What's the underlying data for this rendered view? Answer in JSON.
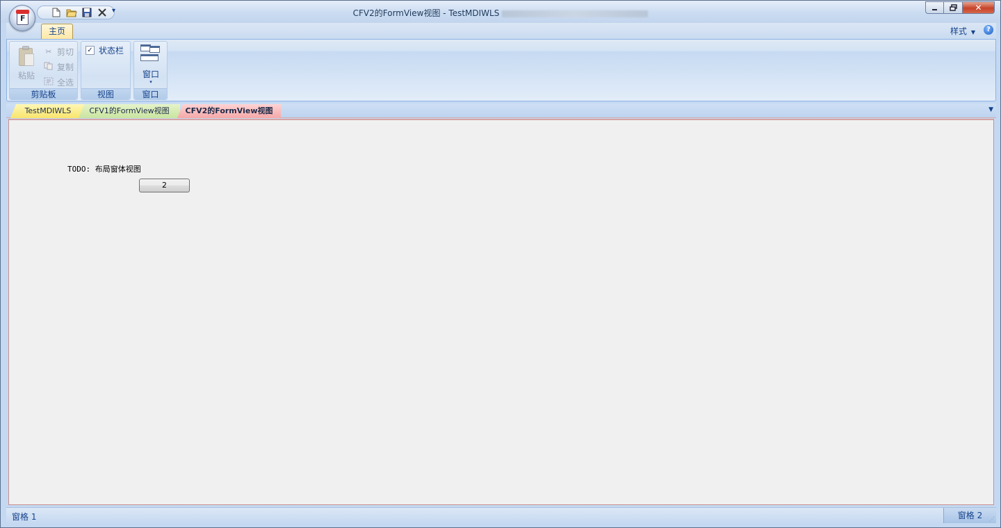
{
  "window": {
    "title": "CFV2的FormView视图 - TestMDIWLS",
    "controls": {
      "minimize": "─",
      "maximize": "□",
      "close": "✕"
    }
  },
  "app_button": {
    "letter": "F"
  },
  "quick_access": {
    "items": [
      {
        "name": "new-document-icon",
        "glyph": "🗋"
      },
      {
        "name": "open-folder-icon",
        "glyph": "📂"
      },
      {
        "name": "save-icon",
        "glyph": "💾"
      },
      {
        "name": "close-document-icon",
        "glyph": "✕"
      }
    ],
    "more": "▾"
  },
  "ribbon": {
    "tabs": [
      {
        "label": "主页",
        "active": true
      }
    ],
    "style_menu": "样式",
    "help": "?",
    "groups": {
      "clipboard": {
        "label": "剪贴板",
        "paste": "粘贴",
        "cut": "剪切",
        "copy": "复制",
        "select_all": "全选"
      },
      "view": {
        "label": "视图",
        "status_bar_checkbox": "状态栏",
        "status_bar_checked": true
      },
      "window": {
        "label": "窗口",
        "window_button": "窗口"
      }
    }
  },
  "mdi_tabs": [
    {
      "label": "TestMDIWLS",
      "color": "#f8e46c"
    },
    {
      "label": "CFV1的FormView视图",
      "color": "#c9e4a0"
    },
    {
      "label": "CFV2的FormView视图",
      "color": "#f4a8a8",
      "active": true
    }
  ],
  "form": {
    "todo_text": "TODO: 布局窗体视图",
    "button_label": "2"
  },
  "statusbar": {
    "pane1": "窗格 1",
    "pane2": "窗格 2"
  },
  "colors": {
    "ribbon_text": "#15428b",
    "active_tab": "#ffe8a6",
    "form_background": "#f0f0f0"
  }
}
